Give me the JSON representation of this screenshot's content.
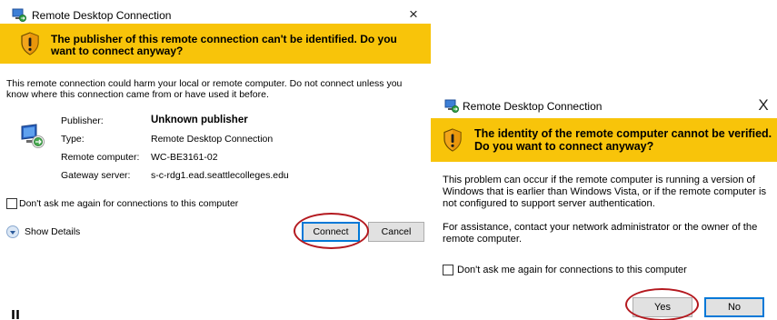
{
  "dialog_left": {
    "title": "Remote Desktop Connection",
    "close_glyph": "×",
    "banner_text": "The publisher of this remote connection can't be identified. Do you want to connect anyway?",
    "warning_text": "This remote connection could harm your local or remote computer. Do not connect unless you know where this connection came from or have used it before.",
    "details": [
      {
        "label": "Publisher:",
        "value": "Unknown publisher"
      },
      {
        "label": "Type:",
        "value": "Remote Desktop Connection"
      },
      {
        "label": "Remote computer:",
        "value": "WC-BE3161-02"
      },
      {
        "label": "Gateway server:",
        "value": "s-c-rdg1.ead.seattlecolleges.edu"
      }
    ],
    "checkbox_label": "Don't ask me again for connections to this computer",
    "checkbox_checked": false,
    "show_details_label": "Show Details",
    "connect_label": "Connect",
    "cancel_label": "Cancel"
  },
  "dialog_right": {
    "title": "Remote Desktop Connection",
    "close_glyph": "X",
    "banner_text": "The identity of the remote computer cannot be verified. Do you want to connect anyway?",
    "problem_text": "This problem can occur if the remote computer is running a version of Windows that is earlier than Windows Vista, or if the remote computer is not configured to support server authentication.",
    "assistance_text": "For assistance, contact your network administrator or the owner of the remote computer.",
    "checkbox_label": "Don't ask me again for connections to this computer",
    "checkbox_checked": false,
    "yes_label": "Yes",
    "no_label": "No"
  },
  "colors": {
    "banner": "#f8c40a",
    "highlight": "#b4191f",
    "default_button_border": "#0078d7"
  },
  "bottom_fragment": "ıı"
}
